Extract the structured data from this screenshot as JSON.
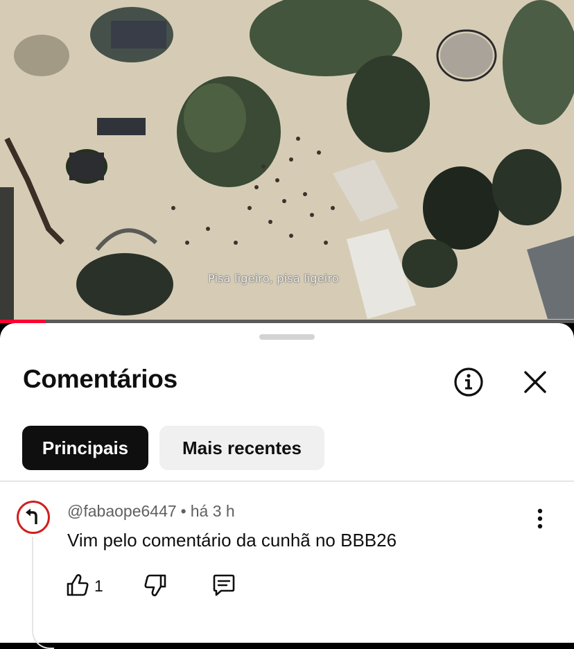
{
  "video": {
    "subtitle": "Pisa ligeiro, pisa ligeiro",
    "progress_percent": 8,
    "accent_color": "#ff0033"
  },
  "comments_panel": {
    "title": "Comentários",
    "info_icon": "info-circle-icon",
    "close_icon": "close-icon",
    "tabs": [
      {
        "label": "Principais",
        "active": true
      },
      {
        "label": "Mais recentes",
        "active": false
      }
    ],
    "comments": [
      {
        "author": "@fabaope6447",
        "separator": "•",
        "time": "há 3 h",
        "text": "Vim pelo comentário da cunhã no BBB26",
        "likes": "1",
        "avatar_icon": "turn-left-sign-icon",
        "actions": [
          "like-icon",
          "dislike-icon",
          "reply-icon",
          "more-vert-icon"
        ]
      }
    ]
  }
}
